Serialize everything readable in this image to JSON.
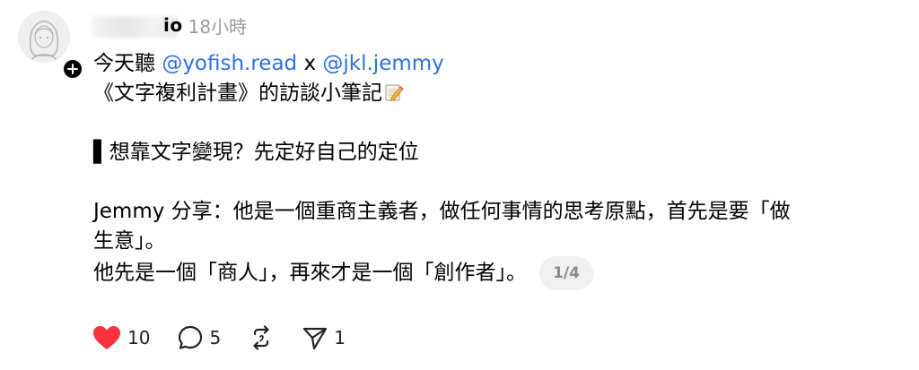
{
  "post": {
    "username": "io",
    "timestamp": "18小時",
    "text_line1_prefix": "今天聽 ",
    "mention1": "@yofish.read",
    "text_line1_mid": " x ",
    "mention2": "@jkl.jemmy",
    "text_line2": "《文字複利計畫》的訪談小筆記",
    "text_line4": "▌想靠文字變現？先定好自己的定位",
    "text_line6": "Jemmy 分享：他是一個重商主義者，做任何事情的思考原點，首先是要「做",
    "text_line7": "生意」。",
    "text_line8": "他先是一個「商人」，再來才是一個「創作者」。",
    "page_indicator": "1/4"
  },
  "actions": {
    "like_count": "10",
    "comment_count": "5",
    "send_count": "1"
  },
  "icons": {
    "like": "heart-icon",
    "comment": "comment-icon",
    "repost": "repost-icon",
    "send": "send-icon",
    "memo": "memo-icon",
    "follow": "plus-icon"
  },
  "colors": {
    "like": "#ff3040",
    "mention": "#2e6fe0",
    "timestamp": "#9a9a9a"
  }
}
